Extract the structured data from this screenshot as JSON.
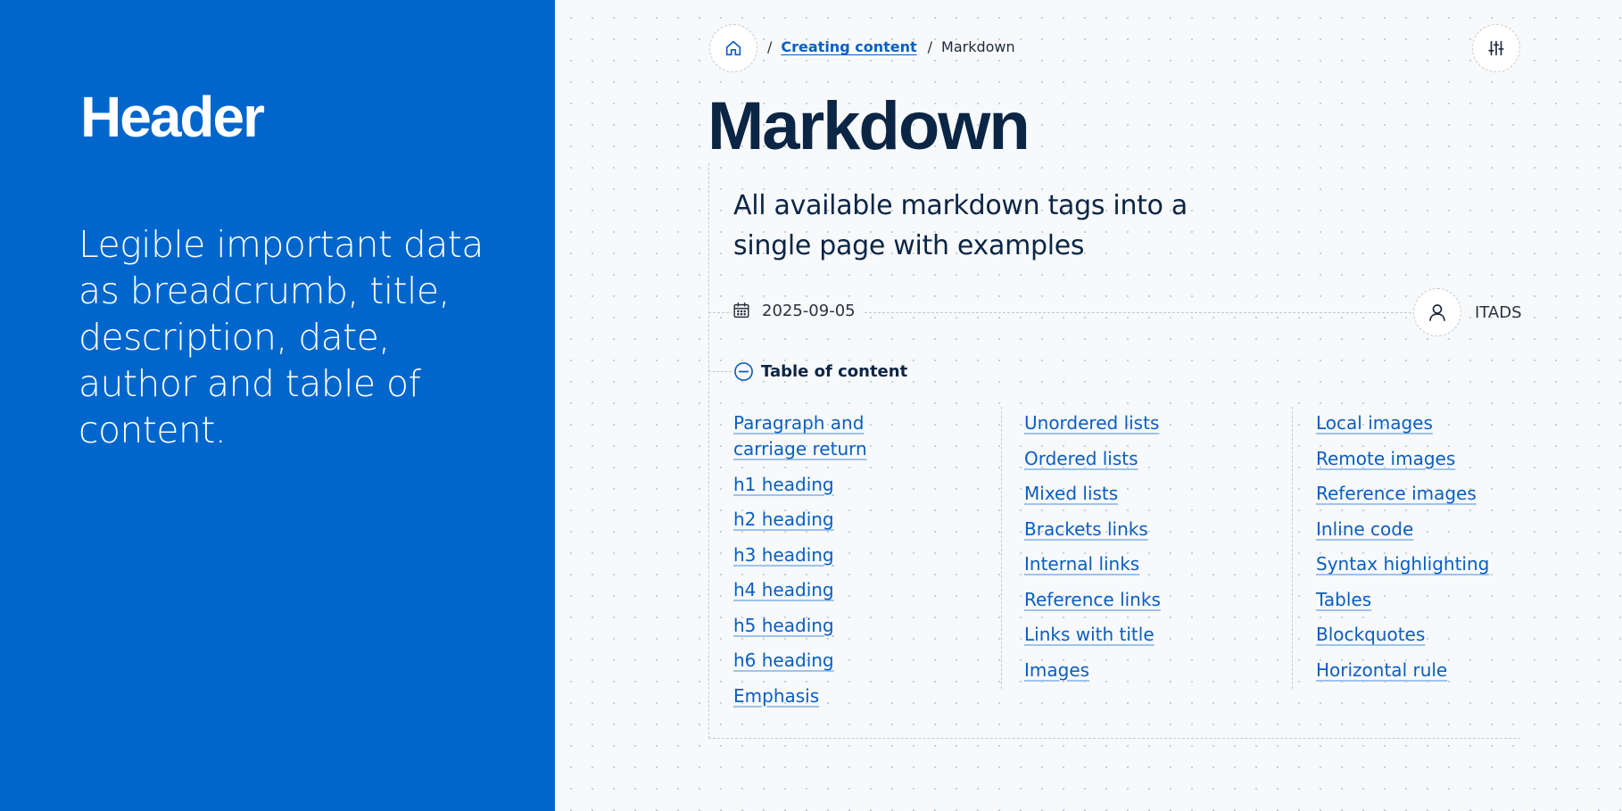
{
  "left": {
    "title": "Header",
    "description": "Legible important data as breadcrumb, title, description, date, author and table of content."
  },
  "breadcrumb": {
    "separator": "/",
    "items": [
      {
        "label": "Creating content",
        "link": true
      },
      {
        "label": "Markdown",
        "link": false
      }
    ]
  },
  "page": {
    "title": "Markdown",
    "description": "All available markdown tags into a single page with examples",
    "date": "2025-09-05",
    "author": "ITADS"
  },
  "toc": {
    "label": "Table of content",
    "columns": [
      [
        "Paragraph and carriage return",
        "h1 heading",
        "h2 heading",
        "h3 heading",
        "h4 heading",
        "h5 heading",
        "h6 heading",
        "Emphasis"
      ],
      [
        "Unordered lists",
        "Ordered lists",
        "Mixed lists",
        "Brackets links",
        "Internal links",
        "Reference links",
        "Links with title",
        "Images"
      ],
      [
        "Local images",
        "Remote images",
        "Reference images",
        "Inline code",
        "Syntax highlighting",
        "Tables",
        "Blockquotes",
        "Horizontal rule"
      ]
    ]
  },
  "icons": {
    "home": "home-icon",
    "settings": "sliders-icon",
    "calendar": "calendar-icon",
    "author": "user-icon",
    "toc_toggle": "minus-circle-icon"
  },
  "colors": {
    "brand_blue": "#0066cc",
    "link": "#0a5ec2",
    "title": "#0b2545"
  }
}
